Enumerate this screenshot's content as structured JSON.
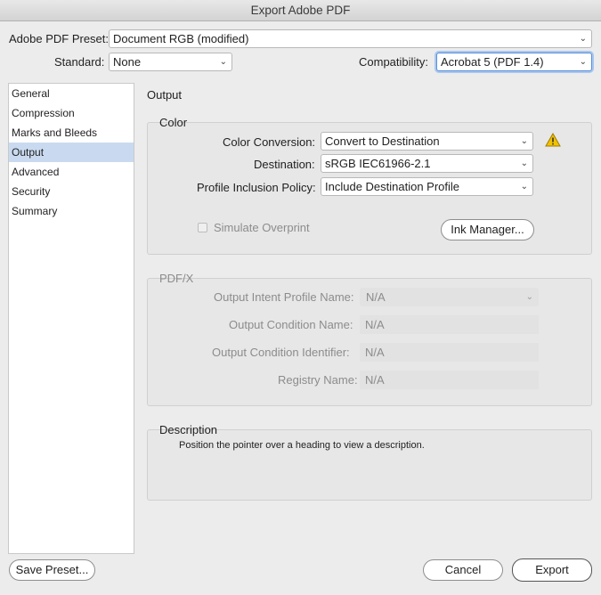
{
  "window": {
    "title": "Export Adobe PDF"
  },
  "top": {
    "preset_label": "Adobe PDF Preset:",
    "preset_value": "Document RGB (modified)",
    "standard_label": "Standard:",
    "standard_value": "None",
    "compat_label": "Compatibility:",
    "compat_value": "Acrobat 5 (PDF 1.4)"
  },
  "sidebar": {
    "items": [
      {
        "label": "General"
      },
      {
        "label": "Compression"
      },
      {
        "label": "Marks and Bleeds"
      },
      {
        "label": "Output",
        "selected": true
      },
      {
        "label": "Advanced"
      },
      {
        "label": "Security"
      },
      {
        "label": "Summary"
      }
    ]
  },
  "main": {
    "section_title": "Output",
    "color": {
      "title": "Color",
      "conversion_label": "Color Conversion:",
      "conversion_value": "Convert to Destination",
      "destination_label": "Destination:",
      "destination_value": "sRGB IEC61966-2.1",
      "policy_label": "Profile Inclusion Policy:",
      "policy_value": "Include Destination Profile",
      "simulate_label": "Simulate Overprint",
      "ink_manager_label": "Ink Manager...",
      "warning_color": "#e8b400"
    },
    "pdfx": {
      "title": "PDF/X",
      "intent_label": "Output Intent Profile Name:",
      "intent_value": "N/A",
      "condition_name_label": "Output Condition Name:",
      "condition_name_value": "N/A",
      "condition_id_label": "Output Condition Identifier:",
      "condition_id_value": "N/A",
      "registry_label": "Registry Name:",
      "registry_value": "N/A"
    },
    "description": {
      "title": "Description",
      "text": "Position the pointer over a heading to view a description."
    }
  },
  "footer": {
    "save_preset_label": "Save Preset...",
    "cancel_label": "Cancel",
    "export_label": "Export"
  },
  "colors": {
    "selection": "#c9daf0",
    "focus": "#5a8fd9"
  }
}
